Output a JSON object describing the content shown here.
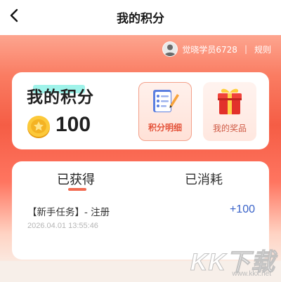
{
  "header": {
    "title": "我的积分",
    "back_icon": "chevron-left-icon"
  },
  "user": {
    "name": "觉晓学员6728",
    "separator": "|",
    "rules_label": "规则"
  },
  "points": {
    "title": "我的积分",
    "value": "100",
    "coin_icon": "coin-icon"
  },
  "tiles": {
    "detail_label": "积分明细",
    "prizes_label": "我的奖品"
  },
  "records": {
    "tabs": [
      {
        "label": "已获得",
        "active": true
      },
      {
        "label": "已消耗",
        "active": false
      }
    ],
    "items": [
      {
        "title": "【新手任务】- 注册",
        "time": "2026.04.01 13:55:46",
        "points": "+100"
      }
    ]
  },
  "watermark": {
    "brand": "KK下载",
    "url": "www.kkx.net"
  },
  "colors": {
    "accent": "#f26a50",
    "points_positive": "#3a63c9",
    "hero_mid": "#f55d45"
  }
}
